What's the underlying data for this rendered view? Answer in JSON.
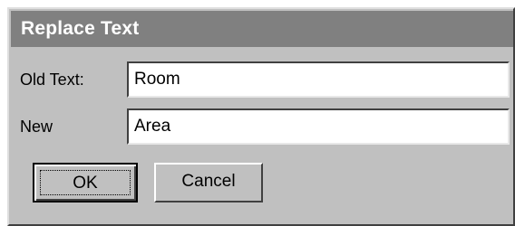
{
  "dialog": {
    "title": "Replace Text",
    "old_text_label": "Old Text:",
    "old_text_value": "Room",
    "new_text_label": "New",
    "new_text_value": "Area",
    "ok_label": "OK",
    "cancel_label": "Cancel"
  },
  "colors": {
    "dialog_bg": "#c0c0c0",
    "titlebar_bg": "#808080",
    "title_text": "#ffffff"
  }
}
